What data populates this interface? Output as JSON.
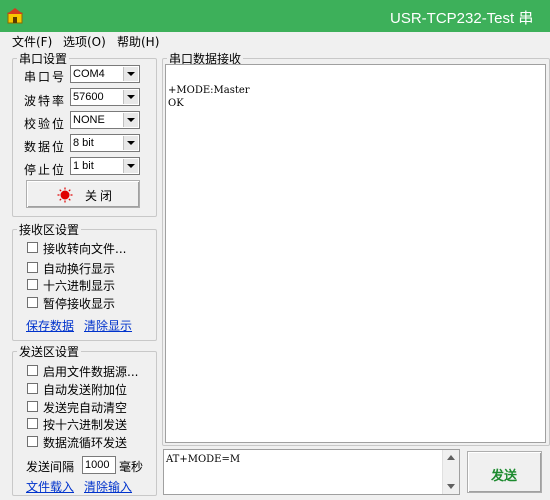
{
  "window": {
    "title": "USR-TCP232-Test 串",
    "accent": "#3db05a"
  },
  "menu": [
    "文件(F)",
    "选项(O)",
    "帮助(H)"
  ],
  "serial": {
    "legend": "串口设置",
    "fields": [
      {
        "label": "串口号",
        "value": "COM4"
      },
      {
        "label": "波特率",
        "value": "57600"
      },
      {
        "label": "校验位",
        "value": "NONE"
      },
      {
        "label": "数据位",
        "value": "8 bit"
      },
      {
        "label": "停止位",
        "value": "1 bit"
      }
    ],
    "close_button": "关闭",
    "status_color": "#e00000"
  },
  "receive_settings": {
    "legend": "接收区设置",
    "options": [
      "接收转向文件...",
      "自动换行显示",
      "十六进制显示",
      "暂停接收显示"
    ],
    "save_link": "保存数据",
    "clear_link": "清除显示"
  },
  "send_settings": {
    "legend": "发送区设置",
    "options": [
      "启用文件数据源...",
      "自动发送附加位",
      "发送完自动清空",
      "按十六进制发送",
      "数据流循环发送"
    ],
    "interval_label": "发送间隔",
    "interval_value": "1000",
    "interval_unit": "毫秒",
    "load_link": "文件载入",
    "clear_link": "清除输入"
  },
  "receive_panel": {
    "legend": "串口数据接收",
    "lines": [
      "+MODE:Master",
      "OK"
    ]
  },
  "send_panel": {
    "input_value": "AT+MODE=M",
    "send_button": "发送",
    "send_color": "#1c8a2e"
  }
}
